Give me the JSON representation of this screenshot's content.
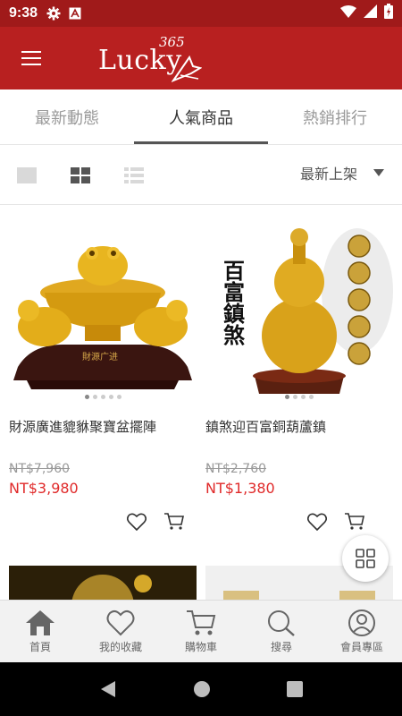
{
  "status_bar": {
    "time": "9:38",
    "icons": [
      "gear-icon",
      "a-badge-icon",
      "wifi-icon",
      "signal-icon",
      "battery-icon"
    ]
  },
  "app_bar": {
    "brand": "Lucky",
    "brand_number": "365"
  },
  "tabs": [
    {
      "label": "最新動態",
      "active": false
    },
    {
      "label": "人氣商品",
      "active": true
    },
    {
      "label": "熱銷排行",
      "active": false
    }
  ],
  "toolbar": {
    "views": [
      "single-view-icon",
      "grid-view-icon",
      "list-view-icon"
    ],
    "sort_label": "最新上架"
  },
  "products": [
    {
      "name": "財源廣進貔貅聚寶盆擺陣",
      "old_price": "NT$7,960",
      "price": "NT$3,980",
      "image": "gold-pixiu-treasure-bowl-image",
      "image_text": "財源广进"
    },
    {
      "name": "鎮煞迎百富銅葫蘆鎮",
      "old_price": "NT$2,760",
      "price": "NT$1,380",
      "image": "gold-gourd-image",
      "image_text": "百富鎮煞"
    }
  ],
  "bottom_nav": [
    {
      "label": "首頁",
      "icon": "home-icon"
    },
    {
      "label": "我的收藏",
      "icon": "heart-icon"
    },
    {
      "label": "購物車",
      "icon": "cart-icon"
    },
    {
      "label": "搜尋",
      "icon": "search-icon"
    },
    {
      "label": "會員專區",
      "icon": "user-icon"
    }
  ],
  "colors": {
    "brand_red": "#b82020",
    "status_red": "#a01a1a",
    "price_red": "#e02a2a"
  }
}
